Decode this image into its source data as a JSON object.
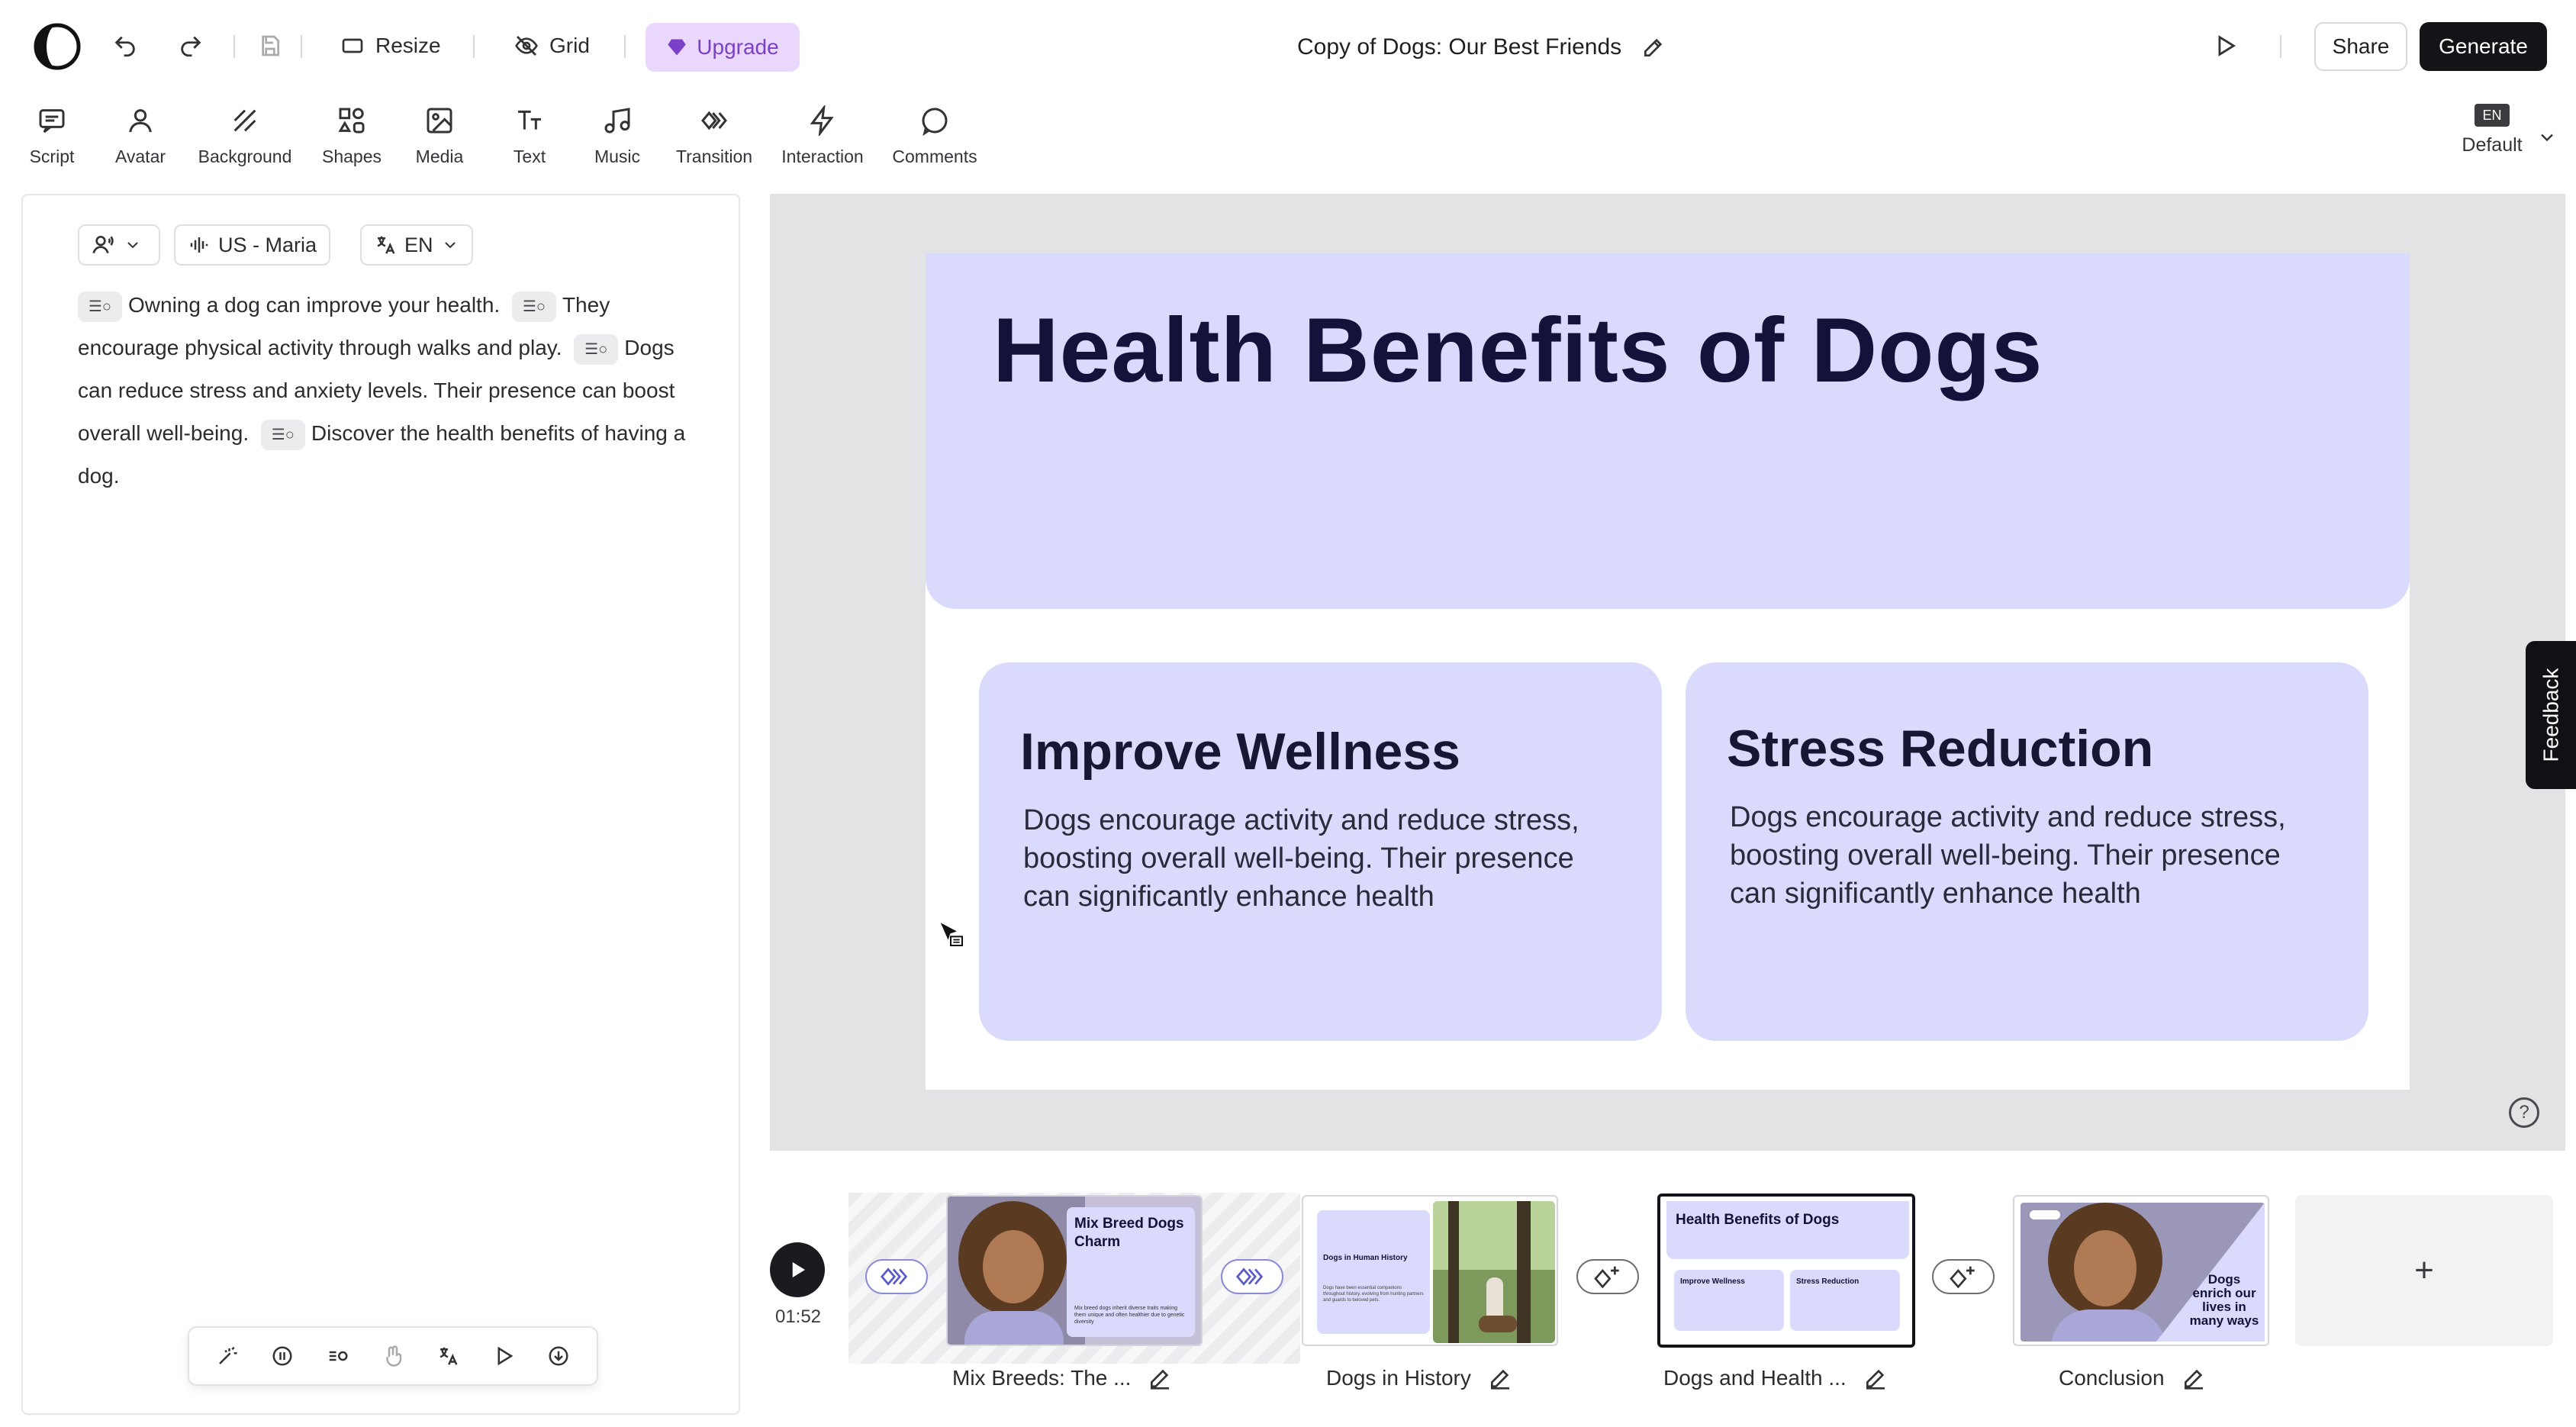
{
  "app": {
    "toolbar_top": {
      "resize_label": "Resize",
      "grid_label": "Grid",
      "upgrade_label": "Upgrade",
      "document_title": "Copy of Dogs: Our Best Friends",
      "share_label": "Share",
      "generate_label": "Generate"
    },
    "tools": [
      {
        "label": "Script",
        "icon": "script-icon"
      },
      {
        "label": "Avatar",
        "icon": "avatar-icon"
      },
      {
        "label": "Background",
        "icon": "background-icon"
      },
      {
        "label": "Shapes",
        "icon": "shapes-icon"
      },
      {
        "label": "Media",
        "icon": "media-icon"
      },
      {
        "label": "Text",
        "icon": "text-icon"
      },
      {
        "label": "Music",
        "icon": "music-icon"
      },
      {
        "label": "Transition",
        "icon": "transition-icon"
      },
      {
        "label": "Interaction",
        "icon": "interaction-icon"
      },
      {
        "label": "Comments",
        "icon": "comments-icon"
      }
    ],
    "language_selector": {
      "badge": "EN",
      "label": "Default"
    },
    "colors": {
      "accent": "#7b3fc8",
      "upgrade_bg": "#e9d8fb",
      "slide_card": "#d9dafc",
      "primary_button": "#141418"
    }
  },
  "script": {
    "voice_label": "US - Maria",
    "language_label": "EN",
    "segments": [
      "Owning a dog can improve your health.",
      "They encourage physical activity through walks and play.",
      "Dogs can reduce stress and anxiety levels. Their presence can boost overall well-being.",
      "Discover the health benefits of having a dog."
    ]
  },
  "slide": {
    "title": "Health Benefits of Dogs",
    "cards": [
      {
        "heading": "Improve Wellness",
        "body": "Dogs encourage activity and reduce stress, boosting overall well-being. Their presence can significantly enhance health"
      },
      {
        "heading": "Stress Reduction",
        "body": "Dogs encourage activity and reduce stress, boosting overall well-being. Their presence can significantly enhance health"
      }
    ],
    "feedback_label": "Feedback",
    "help_label": "?"
  },
  "timeline": {
    "duration": "01:52",
    "slides": [
      {
        "label": "Mix Breeds: The ...",
        "thumb_title": "Mix Breed Dogs Charm",
        "thumb_body": "Mix breed dogs inherit diverse traits making them unique and often healthier due to genetic diversity"
      },
      {
        "label": "Dogs in History",
        "thumb_title": "Dogs in Human History",
        "thumb_body": "Dogs have been essential companions throughout history, evolving from hunting partners and guards to beloved pets."
      },
      {
        "label": "Dogs and Health ...",
        "thumb_title": "Health Benefits of Dogs",
        "thumb_card1": "Improve Wellness",
        "thumb_card2": "Stress Reduction"
      },
      {
        "label": "Conclusion",
        "thumb_title": "Dogs enrich our lives in many ways"
      }
    ],
    "add_label": "+"
  }
}
